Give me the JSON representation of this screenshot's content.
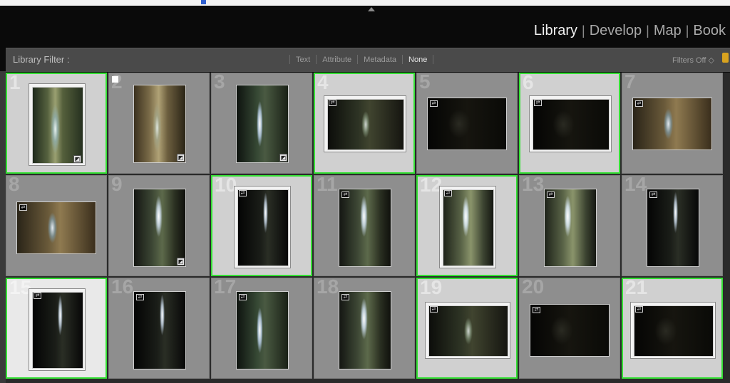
{
  "window_titlebar": "Library Filter",
  "modules": [
    {
      "label": "Library",
      "active": true
    },
    {
      "label": "Develop",
      "active": false
    },
    {
      "label": "Map",
      "active": false
    },
    {
      "label": "Book",
      "active": false
    }
  ],
  "filter_bar": {
    "title": "Library Filter :",
    "options": [
      "Text",
      "Attribute",
      "Metadata",
      "None"
    ],
    "active_option": "None",
    "filters_off": "Filters Off"
  },
  "grid": {
    "cells": [
      {
        "num": "1",
        "selected": true
      },
      {
        "num": "2",
        "selected": false
      },
      {
        "num": "3",
        "selected": false
      },
      {
        "num": "4",
        "selected": true
      },
      {
        "num": "5",
        "selected": false
      },
      {
        "num": "6",
        "selected": true
      },
      {
        "num": "7",
        "selected": false
      },
      {
        "num": "8",
        "selected": false
      },
      {
        "num": "9",
        "selected": false
      },
      {
        "num": "10",
        "selected": true
      },
      {
        "num": "11",
        "selected": false
      },
      {
        "num": "12",
        "selected": true
      },
      {
        "num": "13",
        "selected": false
      },
      {
        "num": "14",
        "selected": false
      },
      {
        "num": "15",
        "selected": true
      },
      {
        "num": "16",
        "selected": false
      },
      {
        "num": "17",
        "selected": false
      },
      {
        "num": "18",
        "selected": false
      },
      {
        "num": "19",
        "selected": true
      },
      {
        "num": "20",
        "selected": false
      },
      {
        "num": "21",
        "selected": true
      }
    ]
  },
  "colors": {
    "selection_border": "#35e035",
    "active_module": "#f0f0f0",
    "inactive_module": "#a9a9a9"
  },
  "icons": {
    "stack_badge": "stack-icon",
    "develop_badge": "edit-icon",
    "flag": "flag-icon",
    "lock": "lock-icon"
  }
}
